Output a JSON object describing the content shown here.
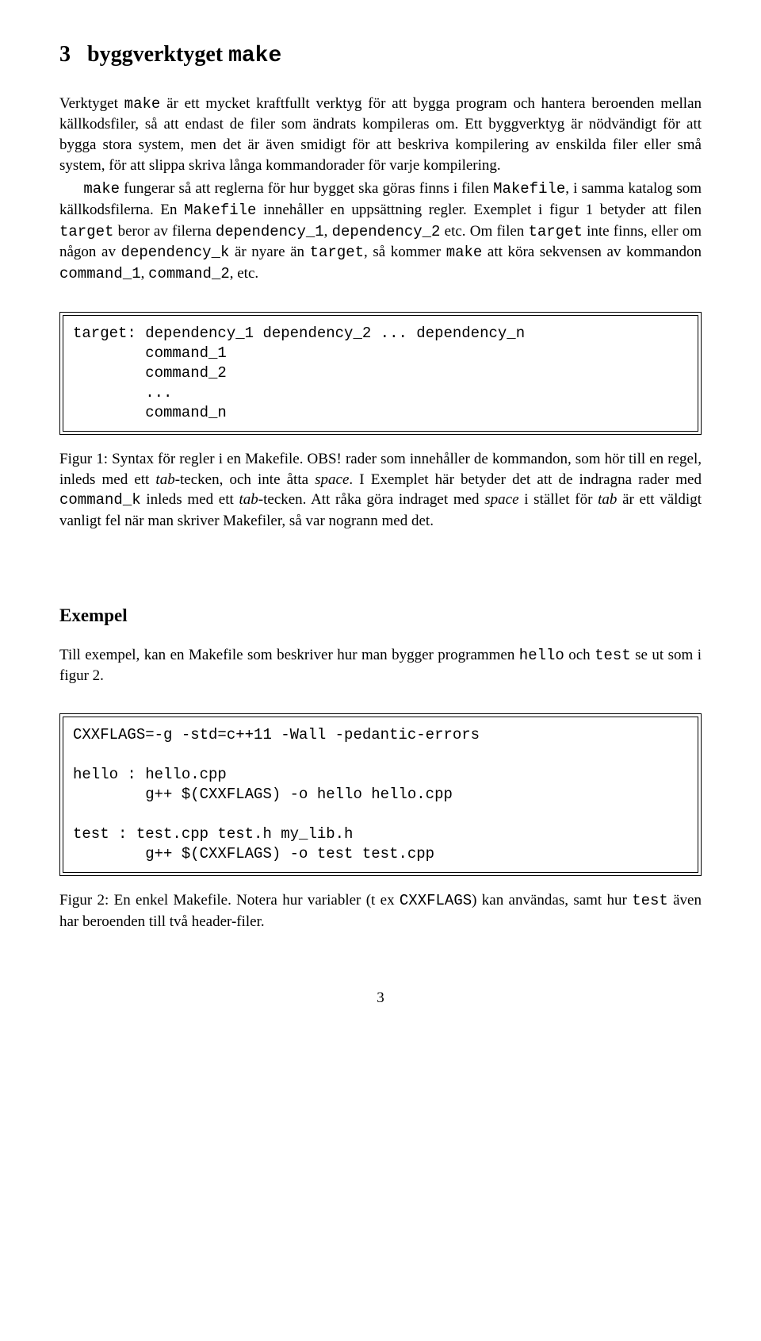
{
  "section": {
    "number": "3",
    "title_plain": "byggverktyget",
    "title_code": "make"
  },
  "para1_a": "Verktyget ",
  "para1_b": "make",
  "para1_c": " är ett mycket kraftfullt verktyg för att bygga program och hantera beroenden mellan källkodsfiler, så att endast de filer som ändrats kompileras om. Ett byggverktyg är nödvändigt för att bygga stora system, men det är även smidigt för att beskriva kompilering av enskilda filer eller små system, för att slippa skriva långa kommandorader för varje kompilering.",
  "para2_a": "make",
  "para2_b": " fungerar så att reglerna för hur bygget ska göras finns i filen ",
  "para2_c": "Makefile",
  "para2_d": ", i samma katalog som källkodsfilerna. En ",
  "para2_e": "Makefile",
  "para2_f": " innehåller en uppsättning regler. Exemplet i figur 1 betyder att filen ",
  "para2_g": "target",
  "para2_h": " beror av filerna ",
  "para2_i": "dependency_1",
  "para2_j": ", ",
  "para2_k": "dependency_2",
  "para2_l": " etc. Om filen ",
  "para2_m": "target",
  "para2_n": " inte finns, eller om någon av ",
  "para2_o": "dependency_k",
  "para2_p": " är nyare än ",
  "para2_q": "target",
  "para2_r": ", så kommer ",
  "para2_s": "make",
  "para2_t": " att köra sekvensen av kommandon ",
  "para2_u": "command_1",
  "para2_v": ", ",
  "para2_w": "command_2",
  "para2_x": ", etc.",
  "figure1_code": "target: dependency_1 dependency_2 ... dependency_n\n        command_1\n        command_2\n        ...\n        command_n",
  "fig1cap_a": "Figur 1: Syntax för regler i en Makefile. OBS! rader som innehåller de kommandon, som hör till en regel, inleds med ett ",
  "fig1cap_b": "tab",
  "fig1cap_c": "-tecken, och inte åtta ",
  "fig1cap_d": "space",
  "fig1cap_e": ". I Exemplet här betyder det att de indragna rader med ",
  "fig1cap_f": "command_k",
  "fig1cap_g": " inleds med ett ",
  "fig1cap_h": "tab",
  "fig1cap_i": "-tecken. Att råka göra indraget med ",
  "fig1cap_j": "space",
  "fig1cap_k": " i stället för ",
  "fig1cap_l": "tab",
  "fig1cap_m": " är ett väldigt vanligt fel när man skriver Makefiler, så var nogrann med det.",
  "exempel_heading": "Exempel",
  "ex_para_a": "Till exempel, kan en Makefile som beskriver hur man bygger programmen ",
  "ex_para_b": "hello",
  "ex_para_c": " och ",
  "ex_para_d": "test",
  "ex_para_e": " se ut som i figur 2.",
  "figure2_code": "CXXFLAGS=-g -std=c++11 -Wall -pedantic-errors\n\nhello : hello.cpp\n        g++ $(CXXFLAGS) -o hello hello.cpp\n\ntest : test.cpp test.h my_lib.h\n        g++ $(CXXFLAGS) -o test test.cpp",
  "fig2cap_a": "Figur 2: En enkel Makefile. Notera hur variabler (t ex ",
  "fig2cap_b": "CXXFLAGS",
  "fig2cap_c": ") kan användas, samt hur ",
  "fig2cap_d": "test",
  "fig2cap_e": " även har beroenden till två header-filer.",
  "page_number": "3"
}
